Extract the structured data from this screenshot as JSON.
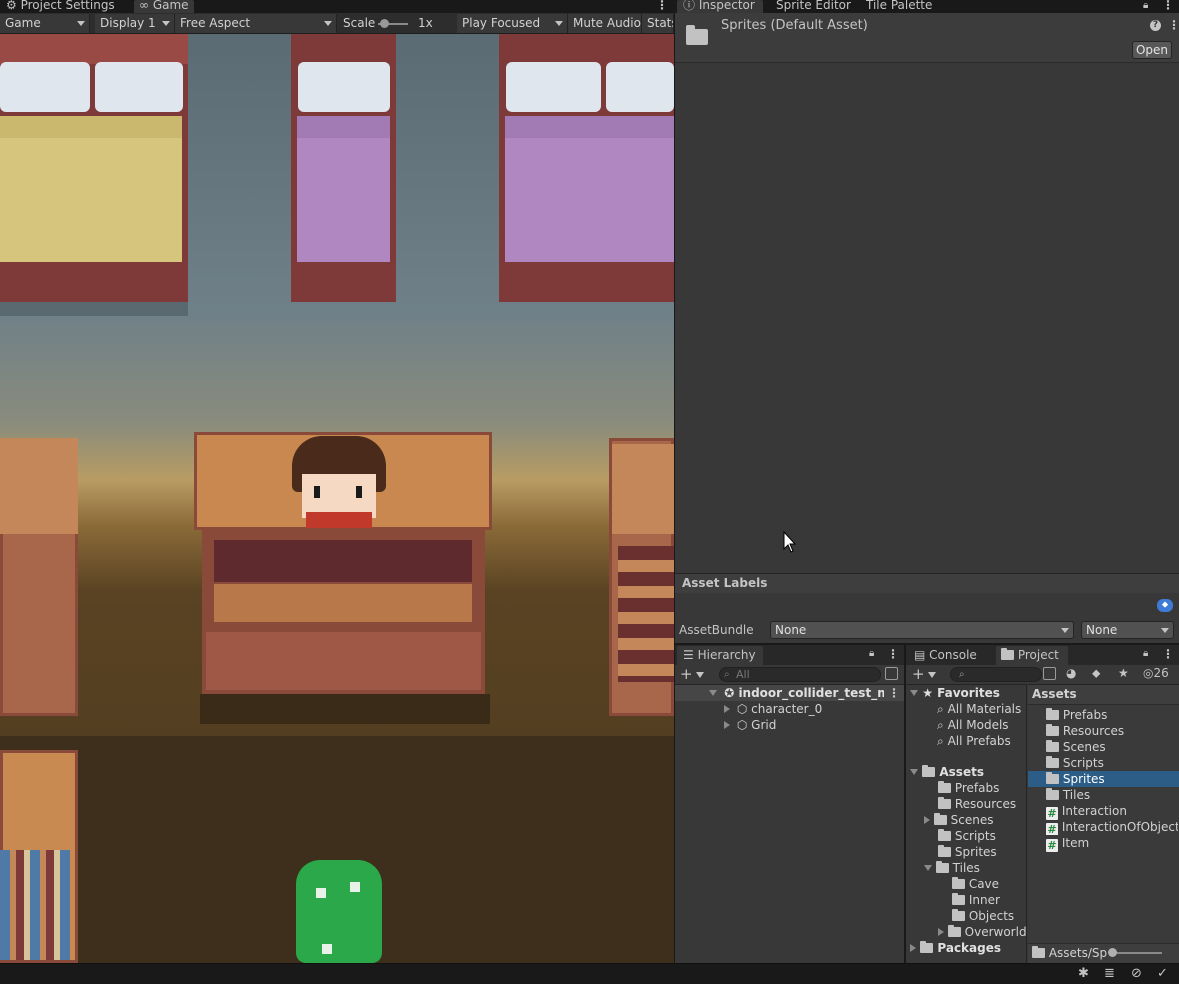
{
  "game_panel": {
    "tabs": [
      {
        "label": "Project Settings",
        "icon": "gear-icon"
      },
      {
        "label": "Game",
        "icon": "gamepad-icon"
      }
    ],
    "toolbar": {
      "view_select": "Game",
      "display_select": "Display 1",
      "aspect_select": "Free Aspect",
      "scale_label": "Scale",
      "scale_value": "1x",
      "play_mode_select": "Play Focused",
      "mute_audio": "Mute Audio",
      "stats": "Stats"
    }
  },
  "inspector": {
    "tabs": [
      {
        "label": "Inspector",
        "icon": "info-icon"
      },
      {
        "label": "Sprite Editor"
      },
      {
        "label": "Tile Palette"
      }
    ],
    "asset_title": "Sprites (Default Asset)",
    "open_button": "Open",
    "asset_labels_title": "Asset Labels",
    "assetbundle_label": "AssetBundle",
    "assetbundle_value": "None",
    "assetbundle_variant": "None"
  },
  "hierarchy": {
    "tab_label": "Hierarchy",
    "search_placeholder": "All",
    "scene_name": "indoor_collider_test_map",
    "children": [
      "character_0",
      "Grid"
    ]
  },
  "project": {
    "tabs": [
      "Console",
      "Project"
    ],
    "hidden_count": "26",
    "favorites_label": "Favorites",
    "favorites": [
      "All Materials",
      "All Models",
      "All Prefabs"
    ],
    "assets_label": "Assets",
    "asset_tree": [
      "Prefabs",
      "Resources",
      "Scenes",
      "Scripts",
      "Sprites"
    ],
    "tiles_label": "Tiles",
    "tiles_children": [
      "Cave",
      "Inner",
      "Objects",
      "Overworld"
    ],
    "packages_label": "Packages",
    "content_header": "Assets",
    "content_folders": [
      "Prefabs",
      "Resources",
      "Scenes",
      "Scripts",
      "Sprites",
      "Tiles"
    ],
    "content_scripts": [
      "Interaction",
      "InteractionOfObject",
      "Item"
    ],
    "selected_item": "Sprites",
    "breadcrumb_path": "Assets/Spr"
  },
  "colors": {
    "panel_bg": "#383838",
    "window_bg": "#191919",
    "selection": "#2c5d87",
    "text": "#c4c4c4"
  }
}
